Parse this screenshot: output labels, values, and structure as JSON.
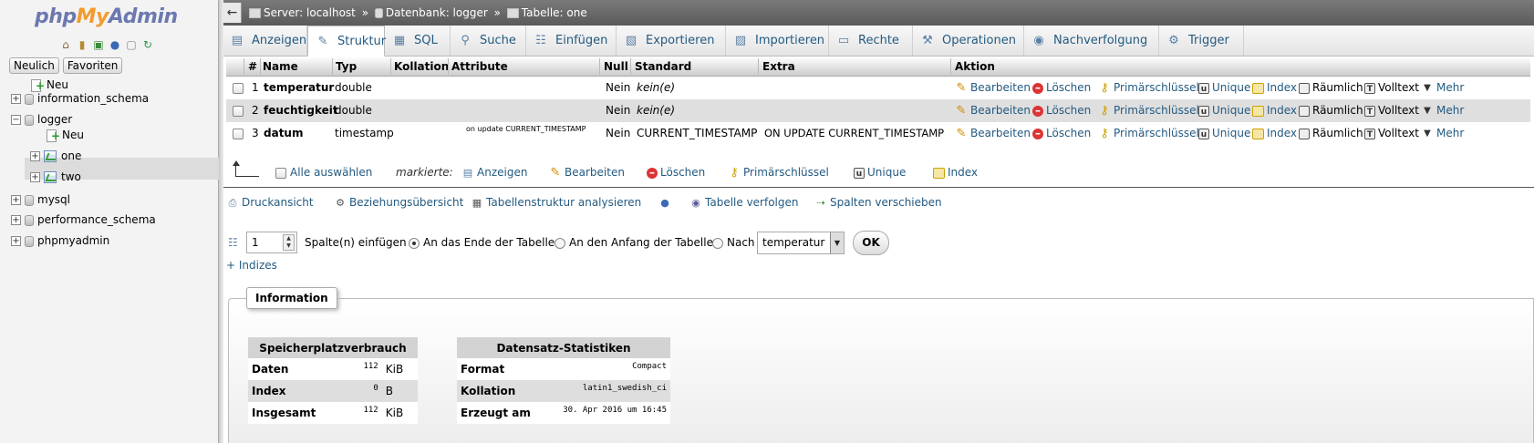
{
  "app": {
    "logo_php": "php",
    "logo_my": "My",
    "logo_admin": "Admin"
  },
  "left": {
    "tab_recent": "Neulich",
    "tab_favorites": "Favoriten",
    "tree": [
      {
        "label": "Neu"
      },
      {
        "label": "information_schema"
      },
      {
        "label": "logger"
      },
      {
        "label": "Neu"
      },
      {
        "label": "one"
      },
      {
        "label": "two"
      },
      {
        "label": "mysql"
      },
      {
        "label": "performance_schema"
      },
      {
        "label": "phpmyadmin"
      }
    ]
  },
  "breadcrumb": {
    "back": "←",
    "server": "Server: localhost",
    "sep1": "»",
    "database": "Datenbank: logger",
    "sep2": "»",
    "table": "Tabelle: one"
  },
  "tabs": [
    {
      "label": "Anzeigen",
      "icon": "browse-icon"
    },
    {
      "label": "Struktur",
      "icon": "structure-icon"
    },
    {
      "label": "SQL",
      "icon": "sql-icon"
    },
    {
      "label": "Suche",
      "icon": "search-icon"
    },
    {
      "label": "Einfügen",
      "icon": "insert-icon"
    },
    {
      "label": "Exportieren",
      "icon": "export-icon"
    },
    {
      "label": "Importieren",
      "icon": "import-icon"
    },
    {
      "label": "Rechte",
      "icon": "privileges-icon"
    },
    {
      "label": "Operationen",
      "icon": "operations-icon"
    },
    {
      "label": "Nachverfolgung",
      "icon": "tracking-icon"
    },
    {
      "label": "Trigger",
      "icon": "trigger-icon"
    }
  ],
  "table": {
    "headers": [
      "#",
      "Name",
      "Typ",
      "Kollation",
      "Attribute",
      "Null",
      "Standard",
      "Extra",
      "Aktion"
    ],
    "rows": [
      {
        "num": "1",
        "name": "temperatur",
        "type": "double",
        "collation": "",
        "attributes": "",
        "null": "Nein",
        "default": "kein(e)",
        "extra": ""
      },
      {
        "num": "2",
        "name": "feuchtigkeit",
        "type": "double",
        "collation": "",
        "attributes": "",
        "null": "Nein",
        "default": "kein(e)",
        "extra": ""
      },
      {
        "num": "3",
        "name": "datum",
        "type": "timestamp",
        "collation": "",
        "attributes": "on update CURRENT_TIMESTAMP",
        "null": "Nein",
        "default": "CURRENT_TIMESTAMP",
        "extra": "ON UPDATE CURRENT_TIMESTAMP"
      }
    ],
    "actions": {
      "edit": "Bearbeiten",
      "delete": "Löschen",
      "primary": "Primärschlüssel",
      "unique": "Unique",
      "index": "Index",
      "spatial": "Räumlich",
      "fulltext": "Volltext",
      "more": "Mehr"
    }
  },
  "selection": {
    "select_all": "Alle auswählen",
    "marked": "markierte:",
    "browse": "Anzeigen",
    "edit": "Bearbeiten",
    "delete": "Löschen",
    "primary": "Primärschlüssel",
    "unique": "Unique",
    "index": "Index"
  },
  "links": {
    "print": "Druckansicht",
    "relation": "Beziehungsübersicht",
    "analyze": "Tabellenstruktur analysieren",
    "track": "Tabelle verfolgen",
    "move": "Spalten verschieben"
  },
  "add_column": {
    "count": "1",
    "label": "Spalte(n) einfügen",
    "opt_end": "An das Ende der Tabelle",
    "opt_begin": "An den Anfang der Tabelle",
    "opt_after": "Nach",
    "after_value": "temperatur",
    "ok": "OK"
  },
  "indexes_link": "+ Indizes",
  "information": {
    "legend": "Information",
    "space": {
      "title": "Speicherplatzverbrauch",
      "rows": [
        {
          "label": "Daten",
          "value": "112",
          "unit": "KiB"
        },
        {
          "label": "Index",
          "value": "0",
          "unit": "B"
        },
        {
          "label": "Insgesamt",
          "value": "112",
          "unit": "KiB"
        }
      ]
    },
    "stats": {
      "title": "Datensatz-Statistiken",
      "rows": [
        {
          "label": "Format",
          "value": "Compact"
        },
        {
          "label": "Kollation",
          "value": "latin1_swedish_ci"
        },
        {
          "label": "Erzeugt am",
          "value": "30. Apr 2016 um 16:45"
        }
      ]
    }
  }
}
